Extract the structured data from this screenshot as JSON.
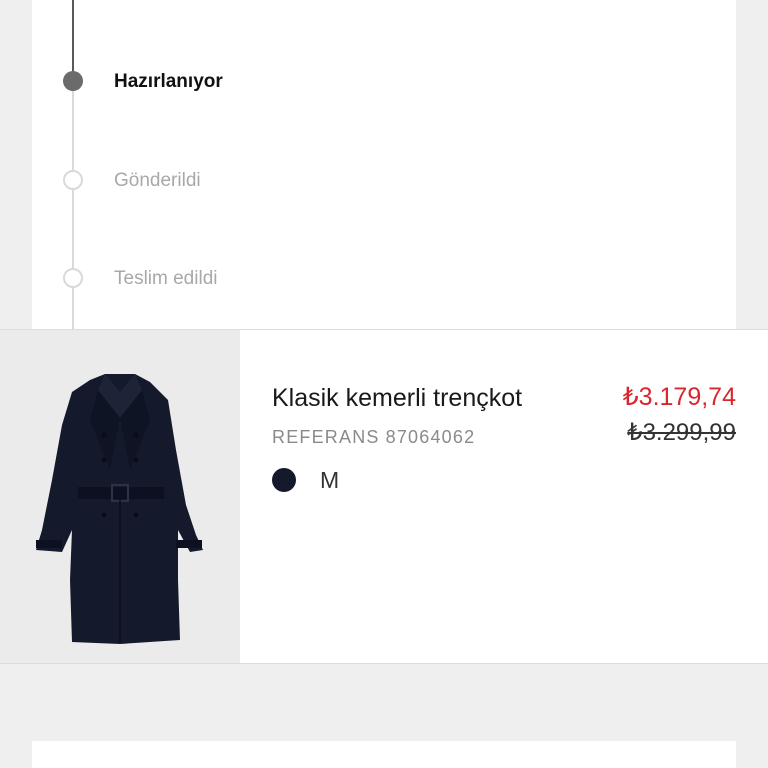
{
  "order_status": {
    "steps": [
      {
        "label": "Hazırlanıyor",
        "state": "active"
      },
      {
        "label": "Gönderildi",
        "state": "pending"
      },
      {
        "label": "Teslim edildi",
        "state": "pending"
      }
    ]
  },
  "product": {
    "name": "Klasik kemerli trençkot",
    "reference_label": "REFERANS",
    "reference_number": "87064062",
    "color": "#141a2c",
    "size": "M",
    "price_sale": "₺3.179,74",
    "price_original": "₺3.299,99",
    "image_icon": "trench-coat-image"
  },
  "colors": {
    "sale_price": "#d8272f",
    "active_step": "#6b6b6b",
    "pending_step": "#d9d9d9",
    "background": "#efefef"
  }
}
